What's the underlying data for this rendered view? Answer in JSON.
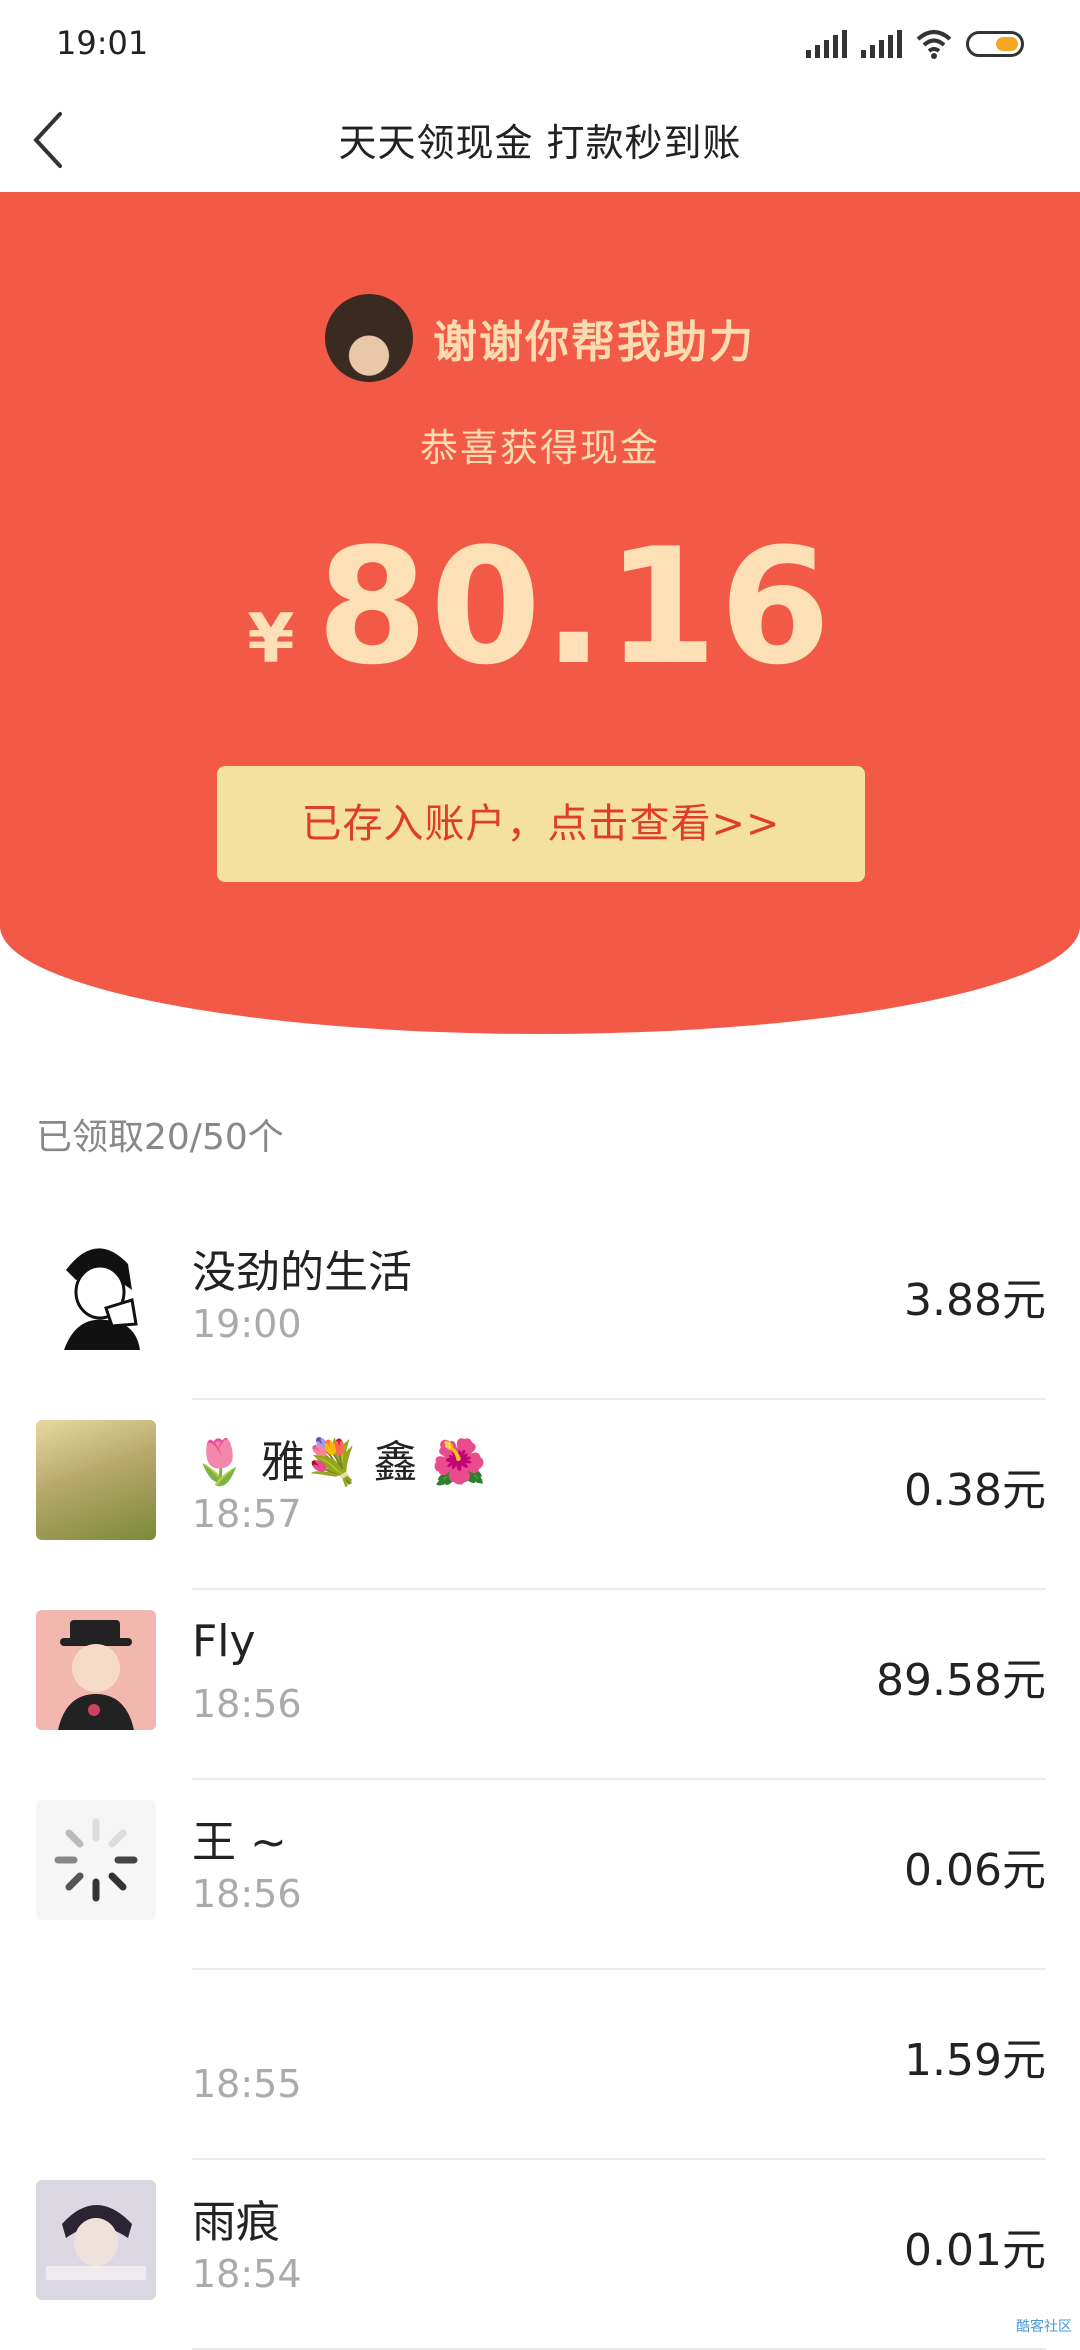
{
  "status": {
    "time": "19:01"
  },
  "nav": {
    "title": "天天领现金 打款秒到账"
  },
  "hero": {
    "helper_text": "谢谢你帮我助力",
    "congrats": "恭喜获得现金",
    "currency": "¥",
    "amount": "80.16",
    "deposit_button": "已存入账户，点击查看>>"
  },
  "received_count": "已领取20/50个",
  "list": [
    {
      "name": "没劲的生活",
      "time": "19:00",
      "amount": "3.88元"
    },
    {
      "name": "🌷 雅💐 鑫 🌺",
      "time": "18:57",
      "amount": "0.38元"
    },
    {
      "name": "Fly",
      "time": "18:56",
      "amount": "89.58元"
    },
    {
      "name": "王 ~",
      "time": "18:56",
      "amount": "0.06元"
    },
    {
      "name": "",
      "time": "18:55",
      "amount": "1.59元"
    },
    {
      "name": "雨痕",
      "time": "18:54",
      "amount": "0.01元"
    }
  ],
  "watermark": "酷客社区",
  "colors": {
    "hero_red": "#f25a47",
    "button_yellow": "#f4e0a1",
    "accent_text": "#fbdcb0"
  }
}
